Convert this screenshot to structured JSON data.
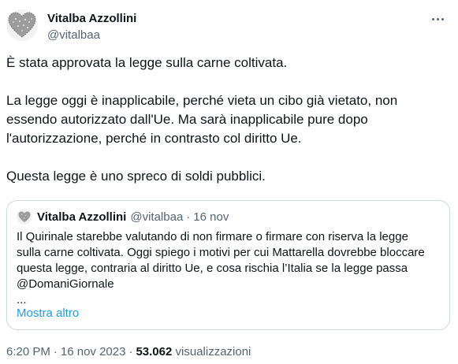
{
  "author": {
    "display_name": "Vitalba Azzollini",
    "handle": "@vitalbaa",
    "avatar_icon": "heart-icon"
  },
  "tweet": {
    "paragraphs": [
      "È stata approvata la legge sulla carne coltivata.",
      "La legge oggi è inapplicabile, perché vieta un cibo già vietato, non essendo autorizzato dall'Ue. Ma sarà inapplicabile pure dopo l'autorizzazione, perché in contrasto col diritto Ue.",
      "Questa legge è uno spreco di soldi pubblici."
    ]
  },
  "quote": {
    "display_name": "Vitalba Azzollini",
    "handle": "@vitalbaa",
    "separator": "·",
    "date": "16 nov",
    "lines": [
      "Il Quirinale starebbe valutando di non firmare o firmare con riserva la legge",
      "sulla carne coltivata. Oggi spiego i motivi per cui Mattarella dovrebbe bloccare",
      "questa legge, contraria al diritto Ue, e cosa rischia l’Italia se la legge passa",
      "@DomaniGiornale",
      "..."
    ],
    "show_more": "Mostra altro"
  },
  "meta": {
    "time": "6:20 PM",
    "separator": "·",
    "date": "16 nov 2023",
    "views_count": "53.062",
    "views_label": "visualizzazioni"
  },
  "colors": {
    "text": "#0f1419",
    "secondary": "#536471",
    "link": "#1d9bf0",
    "border": "#cfd9de"
  }
}
